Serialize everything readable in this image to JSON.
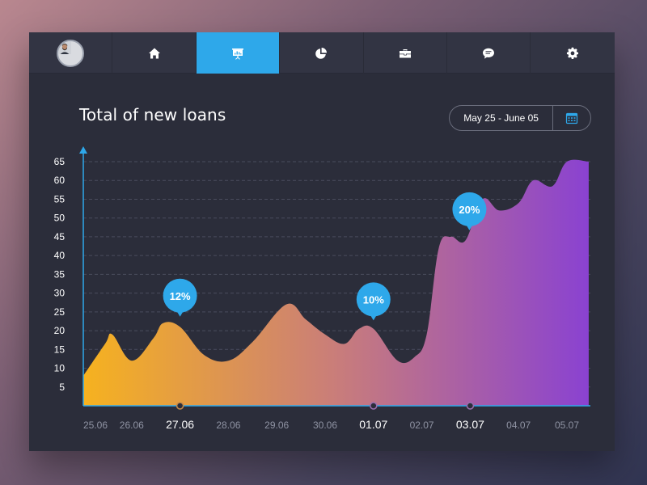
{
  "nav": {
    "items": [
      {
        "id": "profile",
        "icon": "avatar",
        "active": false
      },
      {
        "id": "home",
        "icon": "home-icon",
        "active": false
      },
      {
        "id": "presentation",
        "icon": "presentation-chart-icon",
        "active": true
      },
      {
        "id": "pie",
        "icon": "pie-chart-icon",
        "active": false
      },
      {
        "id": "briefcase",
        "icon": "briefcase-icon",
        "active": false
      },
      {
        "id": "chat",
        "icon": "chat-bubble-icon",
        "active": false
      },
      {
        "id": "settings",
        "icon": "gear-icon",
        "active": false
      }
    ]
  },
  "header": {
    "title": "Total of new loans",
    "date_range": "May 25 - June 05",
    "calendar_icon": "calendar-icon"
  },
  "colors": {
    "card_bg": "#2b2d3a",
    "accent_blue": "#2ea8ea",
    "gradient_start": "#f6b21f",
    "gradient_mid": "#c97d7a",
    "gradient_end": "#8a42d1"
  },
  "chart_data": {
    "type": "area",
    "title": "Total of new loans",
    "xlabel": "",
    "ylabel": "",
    "ylim": [
      0,
      65
    ],
    "yticks": [
      5,
      10,
      15,
      20,
      25,
      30,
      35,
      40,
      45,
      50,
      55,
      60,
      65
    ],
    "grid": true,
    "categories": [
      "25.06",
      "26.06",
      "27.06",
      "28.06",
      "29.06",
      "30.06",
      "01.07",
      "02.07",
      "03.07",
      "04.07",
      "05.07"
    ],
    "highlighted": [
      "27.06",
      "01.07",
      "03.07"
    ],
    "points": [
      [
        0,
        8
      ],
      [
        0.45,
        16.5
      ],
      [
        0.6,
        19
      ],
      [
        1.0,
        12
      ],
      [
        1.45,
        18
      ],
      [
        1.65,
        22
      ],
      [
        2.0,
        21
      ],
      [
        2.5,
        13.5
      ],
      [
        3.0,
        12
      ],
      [
        3.5,
        17
      ],
      [
        4.2,
        27
      ],
      [
        4.6,
        23
      ],
      [
        5.0,
        19
      ],
      [
        5.4,
        16.5
      ],
      [
        5.7,
        20.5
      ],
      [
        6.0,
        20.5
      ],
      [
        6.5,
        12
      ],
      [
        6.85,
        13
      ],
      [
        7.1,
        19
      ],
      [
        7.35,
        42
      ],
      [
        7.6,
        45
      ],
      [
        7.9,
        44
      ],
      [
        8.25,
        55
      ],
      [
        8.6,
        52
      ],
      [
        9.0,
        54
      ],
      [
        9.3,
        60
      ],
      [
        9.7,
        58.5
      ],
      [
        10.0,
        65
      ],
      [
        10.45,
        65
      ]
    ],
    "annotations": [
      {
        "label": "12%",
        "x": 2,
        "y": 22
      },
      {
        "label": "10%",
        "x": 6,
        "y": 21
      },
      {
        "label": "20%",
        "x": 7.9,
        "y": 45
      }
    ]
  }
}
